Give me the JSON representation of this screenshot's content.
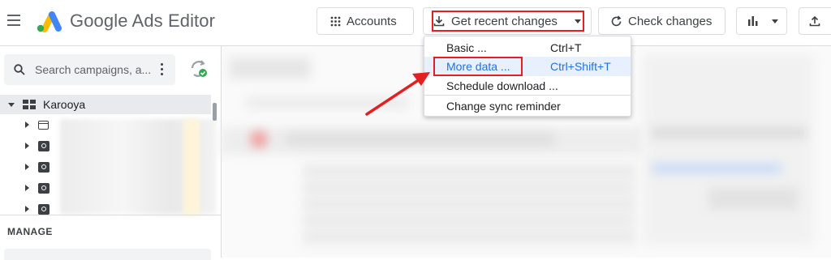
{
  "app": {
    "brand": "Google Ads Editor"
  },
  "toolbar": {
    "accounts_label": "Accounts",
    "get_recent_label": "Get recent changes",
    "check_changes_label": "Check changes"
  },
  "sidebar": {
    "search_placeholder": "Search campaigns, a...",
    "account_name": "Karooya",
    "manage_heading": "MANAGE"
  },
  "dropdown": {
    "items": [
      {
        "label": "Basic ...",
        "shortcut": "Ctrl+T"
      },
      {
        "label": "More data ...",
        "shortcut": "Ctrl+Shift+T"
      },
      {
        "label": "Schedule download ...",
        "shortcut": ""
      },
      {
        "label": "Change sync reminder",
        "shortcut": ""
      }
    ],
    "active_index": 1
  },
  "colors": {
    "highlight": "#e31f1f",
    "active_text": "#1a73e8",
    "active_bg": "#e8f0fe",
    "google_blue": "#4285f4",
    "google_yellow": "#fbbc04",
    "google_green": "#34a853"
  }
}
